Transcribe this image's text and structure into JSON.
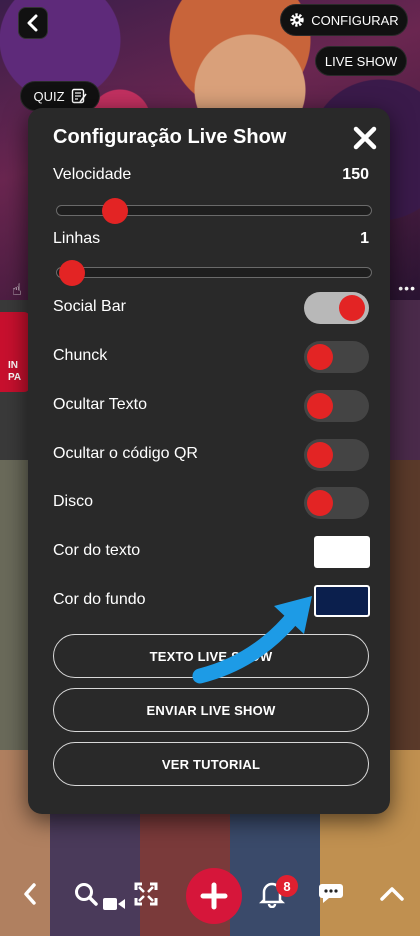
{
  "header": {
    "configurar_label": "CONFIGURAR",
    "live_show_label": "LIVE SHOW",
    "quiz_label": "QUIZ"
  },
  "background": {
    "side_text": "IN\nPA"
  },
  "modal": {
    "title": "Configuração Live Show",
    "velocidade": {
      "label": "Velocidade",
      "value": "150",
      "fraction": 0.15
    },
    "linhas": {
      "label": "Linhas",
      "value": "1",
      "fraction": 0.0
    },
    "toggles": [
      {
        "label": "Social Bar",
        "on": true
      },
      {
        "label": "Chunck",
        "on": false
      },
      {
        "label": "Ocultar Texto",
        "on": false
      },
      {
        "label": "Ocultar o código QR",
        "on": false
      },
      {
        "label": "Disco",
        "on": false
      }
    ],
    "cor_texto": {
      "label": "Cor do texto",
      "color": "#ffffff"
    },
    "cor_fundo": {
      "label": "Cor do fundo",
      "color": "#0b1f4d"
    },
    "buttons": {
      "texto": "TEXTO LIVE SHOW",
      "enviar": "ENVIAR LIVE SHOW",
      "tutorial": "VER TUTORIAL"
    }
  },
  "nav": {
    "notification_count": "8"
  },
  "colors": {
    "accent": "#e32424",
    "fab": "#d6163a",
    "modal_bg": "#292929",
    "arrow": "#1d9be6"
  },
  "icons": [
    "back-icon",
    "gear-icon",
    "edit-icon",
    "close-icon",
    "chevron-left-icon",
    "search-icon",
    "video-icon",
    "fullscreen-icon",
    "plus-icon",
    "bell-icon",
    "chat-icon",
    "chevron-up-icon"
  ]
}
